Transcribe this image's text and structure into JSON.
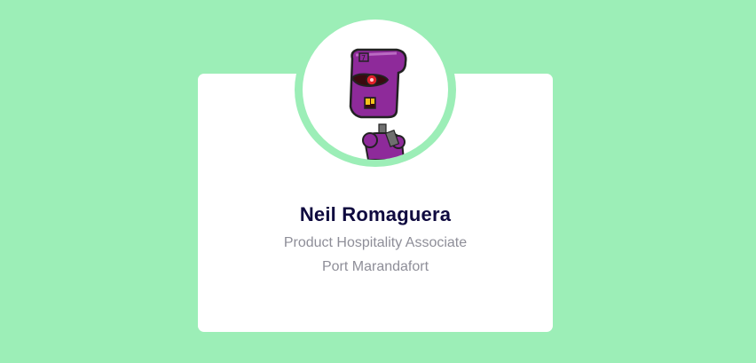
{
  "profile": {
    "name": "Neil Romaguera",
    "job_title": "Product Hospitality Associate",
    "location": "Port Marandafort",
    "avatar_icon": "robot-avatar-icon"
  },
  "colors": {
    "background": "#9ceeb7",
    "card": "#ffffff",
    "name_text": "#0f0a3f",
    "secondary_text": "#8e8e98",
    "robot_body": "#8e2a9a"
  }
}
